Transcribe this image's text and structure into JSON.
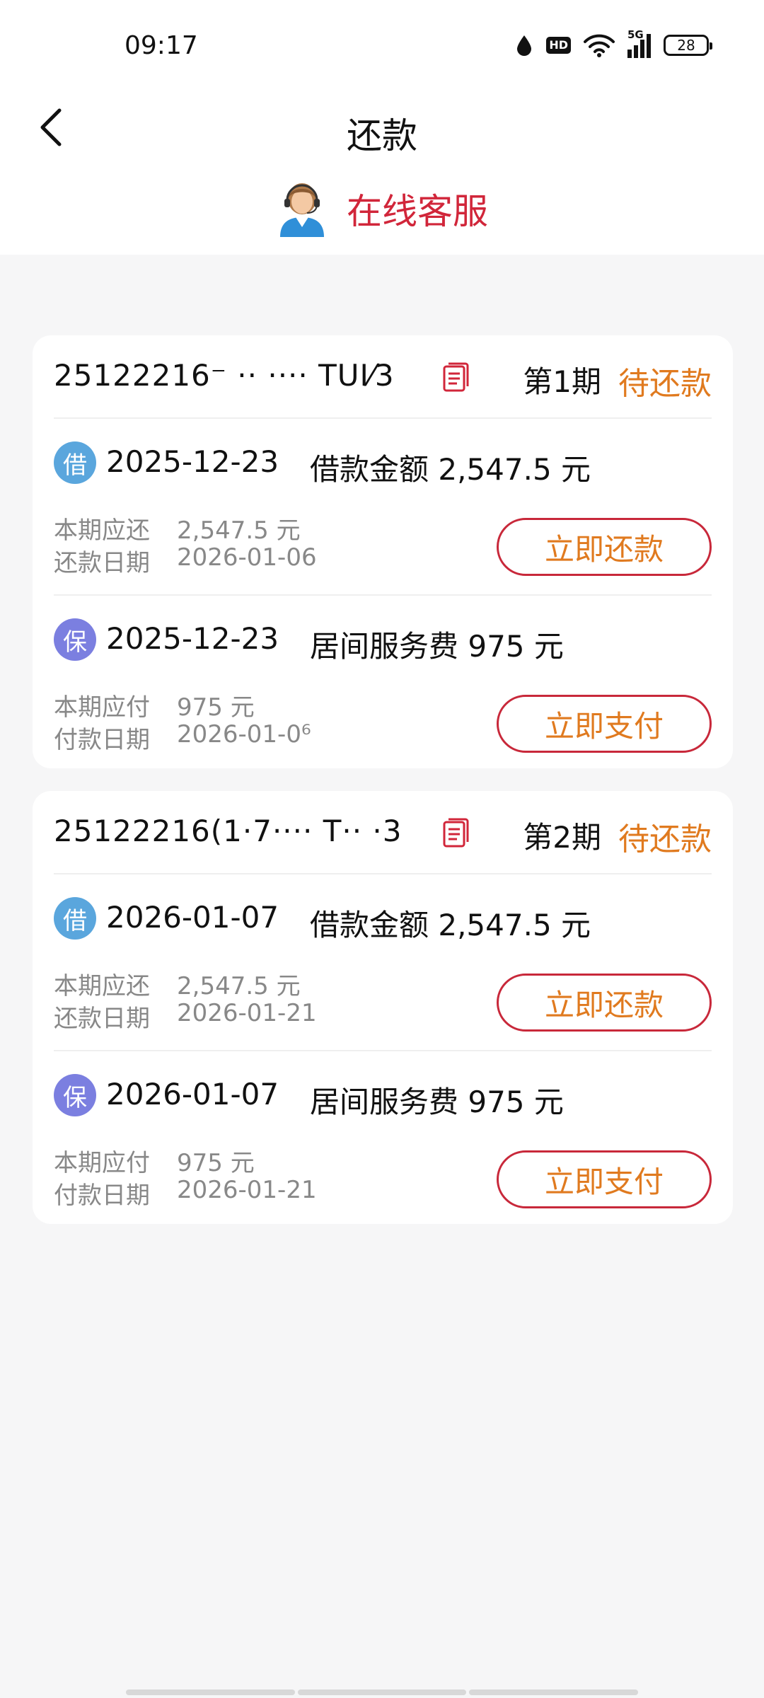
{
  "status_bar": {
    "time": "09:17",
    "hd": "HD",
    "network": "5G",
    "battery": "28"
  },
  "header": {
    "title": "还款",
    "back_icon": "chevron-left-icon"
  },
  "service": {
    "label": "在线客服",
    "icon": "customer-service-agent-icon"
  },
  "colors": {
    "accent_red": "#d1263a",
    "status_orange": "#e07a1f",
    "loan_badge": "#5aa6dd",
    "fee_badge": "#7b7fe0"
  },
  "cards": [
    {
      "order_no": "25122216⁻ ·· ···· TUI⁄3",
      "period": "第1期",
      "status": "待还款",
      "items": [
        {
          "badge": "借",
          "date": "2025-12-23",
          "desc": "借款金额 2,547.5 元",
          "row1_label": "本期应还",
          "row1_value": "2,547.5 元",
          "row2_label": "还款日期",
          "row2_value": "2026-01-06",
          "button": "立即还款"
        },
        {
          "badge": "保",
          "date": "2025-12-23",
          "desc": "居间服务费 975 元",
          "row1_label": "本期应付",
          "row1_value": "975 元",
          "row2_label": "付款日期",
          "row2_value": "2026-01-0⁶",
          "button": "立即支付"
        }
      ]
    },
    {
      "order_no": "25122216(1·7···· T·· ·3",
      "period": "第2期",
      "status": "待还款",
      "items": [
        {
          "badge": "借",
          "date": "2026-01-07",
          "desc": "借款金额 2,547.5 元",
          "row1_label": "本期应还",
          "row1_value": "2,547.5 元",
          "row2_label": "还款日期",
          "row2_value": "2026-01-21",
          "button": "立即还款"
        },
        {
          "badge": "保",
          "date": "2026-01-07",
          "desc": "居间服务费 975 元",
          "row1_label": "本期应付",
          "row1_value": "975 元",
          "row2_label": "付款日期",
          "row2_value": "2026-01-21",
          "button": "立即支付"
        }
      ]
    }
  ]
}
